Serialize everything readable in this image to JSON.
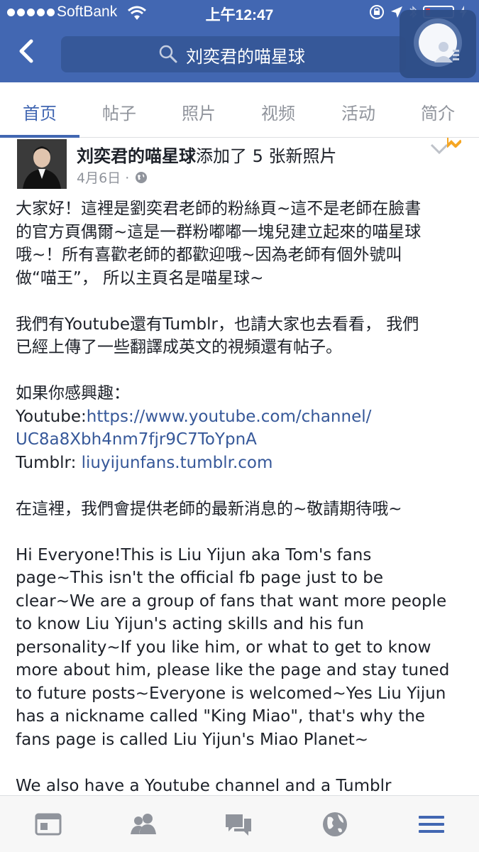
{
  "status_bar": {
    "carrier": "SoftBank",
    "time": "上午12:47",
    "battery_level": 0.12
  },
  "header": {
    "search_text": "刘奕君的喵星球"
  },
  "tabs": [
    {
      "label": "首页",
      "active": true
    },
    {
      "label": "帖子",
      "active": false
    },
    {
      "label": "照片",
      "active": false
    },
    {
      "label": "视频",
      "active": false
    },
    {
      "label": "活动",
      "active": false
    },
    {
      "label": "简介",
      "active": false
    }
  ],
  "post": {
    "author": "刘奕君的喵星球",
    "action": "添加了 5 张新照片",
    "date": "4月6日 ·",
    "body_lines": [
      {
        "t": "大家好！這裡是劉奕君老師的粉絲頁~這不是老師在臉書"
      },
      {
        "t": "的官方頁偶爾~這是一群粉嘟嘟一塊兒建立起來的喵星球"
      },
      {
        "t": "哦~！所有喜歡老師的都歡迎哦~因為老師有個外號叫"
      },
      {
        "t": "做“喵王”， 所以主頁名是喵星球~"
      },
      {
        "t": ""
      },
      {
        "t": "我們有Youtube還有Tumblr，也請大家也去看看， 我們"
      },
      {
        "t": "已經上傳了一些翻譯成英文的視頻還有帖子。"
      },
      {
        "t": ""
      },
      {
        "t": "如果你感興趣："
      },
      {
        "t": "Youtube:",
        "link": "https://www.youtube.com/channel/"
      },
      {
        "t": "",
        "link": "UC8a8Xbh4nm7fjr9C7ToYpnA"
      },
      {
        "t": "Tumblr: ",
        "link": "liuyijunfans.tumblr.com"
      },
      {
        "t": ""
      },
      {
        "t": "在這裡，我們會提供老師的最新消息的~敬請期待哦~"
      },
      {
        "t": ""
      },
      {
        "t": "Hi Everyone!This is Liu Yijun aka Tom's fans"
      },
      {
        "t": "page~This isn't the official fb page just to be"
      },
      {
        "t": "clear~We are a group of fans that want more people"
      },
      {
        "t": "to know Liu Yijun's acting skills and his fun"
      },
      {
        "t": "personality~If you like him, or what to get to know"
      },
      {
        "t": "more about him, please like the page and stay tuned"
      },
      {
        "t": "to future posts~Everyone is welcomed~Yes Liu Yijun"
      },
      {
        "t": "has a nickname called \"King Miao\", that's why the"
      },
      {
        "t": "fans page is called Liu Yijun's Miao Planet~"
      },
      {
        "t": ""
      },
      {
        "t": "We also have a Youtube channel and a Tumblr"
      }
    ]
  },
  "bottom_nav": [
    {
      "icon": "news-feed-icon"
    },
    {
      "icon": "friends-icon"
    },
    {
      "icon": "messages-icon"
    },
    {
      "icon": "globe-icon"
    },
    {
      "icon": "menu-icon",
      "active": true
    }
  ],
  "colors": {
    "brand": "#4267b2",
    "link": "#365899",
    "muted": "#90949c"
  }
}
